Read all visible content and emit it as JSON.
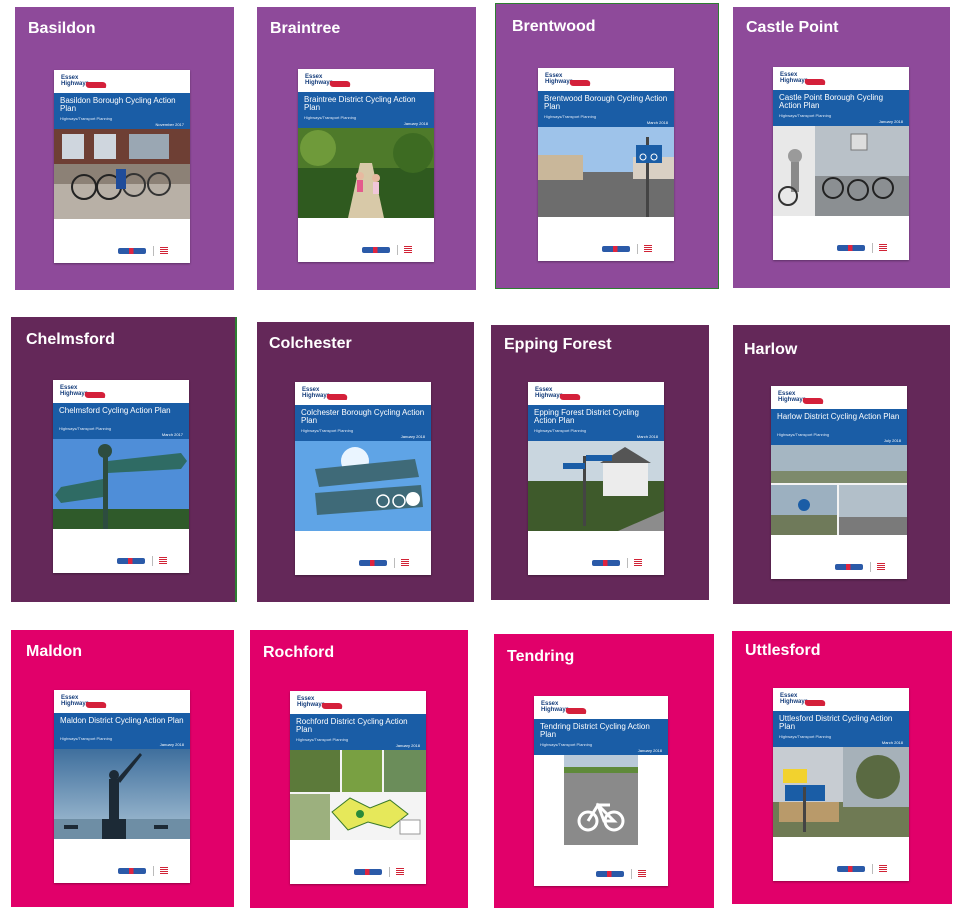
{
  "brand": {
    "line1": "Essex",
    "line2": "Highways"
  },
  "colors": {
    "purple": "#8e4a9a",
    "plum": "#642859",
    "magenta": "#e1006a",
    "cover_band": "#1a5da6"
  },
  "tiles": [
    {
      "title": "Basildon",
      "cover_title": "Basildon Borough Cycling Action Plan",
      "subtitle": "Highways/Transport Planning",
      "date": "November 2017"
    },
    {
      "title": "Braintree",
      "cover_title": "Braintree District Cycling Action Plan",
      "subtitle": "Highways/Transport Planning",
      "date": "January 2018"
    },
    {
      "title": "Brentwood",
      "cover_title": "Brentwood Borough Cycling Action Plan",
      "subtitle": "Highways/Transport Planning",
      "date": "March 2018"
    },
    {
      "title": "Castle Point",
      "cover_title": "Castle Point Borough Cycling Action Plan",
      "subtitle": "Highways/Transport Planning",
      "date": "January 2018"
    },
    {
      "title": "Chelmsford",
      "cover_title": "Chelmsford Cycling Action Plan",
      "subtitle": "Highways/Transport Planning",
      "date": "March 2017"
    },
    {
      "title": "Colchester",
      "cover_title": "Colchester Borough Cycling Action Plan",
      "subtitle": "Highways/Transport Planning",
      "date": "January 2018"
    },
    {
      "title": "Epping Forest",
      "cover_title": "Epping Forest District Cycling Action Plan",
      "subtitle": "Highways/Transport Planning",
      "date": "March 2018"
    },
    {
      "title": "Harlow",
      "cover_title": "Harlow District Cycling Action Plan",
      "subtitle": "Highways/Transport Planning",
      "date": "July 2018"
    },
    {
      "title": "Maldon",
      "cover_title": "Maldon District Cycling Action Plan",
      "subtitle": "Highways/Transport Planning",
      "date": "January 2018"
    },
    {
      "title": "Rochford",
      "cover_title": "Rochford District Cycling Action Plan",
      "subtitle": "Highways/Transport Planning",
      "date": "January 2018"
    },
    {
      "title": "Tendring",
      "cover_title": "Tendring District Cycling Action Plan",
      "subtitle": "Highways/Transport Planning",
      "date": "January 2018"
    },
    {
      "title": "Uttlesford",
      "cover_title": "Uttlesford District Cycling Action Plan",
      "subtitle": "Highways/Transport Planning",
      "date": "March 2018"
    }
  ]
}
